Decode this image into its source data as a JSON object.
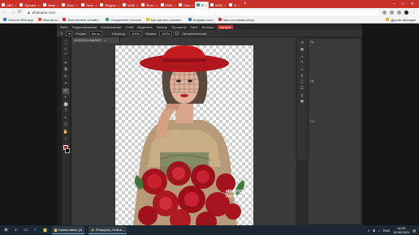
{
  "browser": {
    "tabs": [
      {
        "label": "НКП"
      },
      {
        "label": "Прочее"
      },
      {
        "label": "Ивар"
      },
      {
        "label": "Пинт"
      },
      {
        "label": "Окно"
      },
      {
        "label": "Яндекс"
      },
      {
        "label": "ИНВ"
      },
      {
        "label": "Фото"
      },
      {
        "label": "ИНВ"
      },
      {
        "label": "Пин"
      },
      {
        "label": "Ф"
      },
      {
        "label": "ИНВ"
      },
      {
        "label": "Ф"
      }
    ],
    "url": "photopea.com",
    "bookmarks": [
      {
        "label": "Outlook Web App",
        "color": "#2b7bd6"
      },
      {
        "label": "Мои фото",
        "color": "#e5572b"
      },
      {
        "label": "Бесплатные онлайн...",
        "color": "#c33"
      },
      {
        "label": "Сохранение текстов",
        "color": "#38a04a"
      },
      {
        "label": "Как сделать ссылки...",
        "color": "#e7b21a"
      },
      {
        "label": "Алфавит кого",
        "color": "#2b7bd6"
      },
      {
        "label": "Как состоянию книгу",
        "color": "#c33"
      },
      {
        "label": "Другие закладки",
        "color": "#e7b21a"
      }
    ]
  },
  "photopea": {
    "menu": [
      "Файл",
      "Редактирование",
      "Изображение",
      "Слой",
      "Выделить",
      "Фильтр",
      "Просмотр",
      "Окно",
      "Больше",
      "Аккаунт"
    ],
    "options": {
      "mode_label": "Режим",
      "mode_value": "Кисть",
      "opacity_label": "Непрозр.",
      "opacity_value": "100%",
      "flow_label": "Нажим",
      "flow_value": "100%",
      "auto_label": "Автоматический"
    },
    "doc_tab": "20210914-WA0007",
    "tools": [
      "⬚",
      "⊹",
      "⌒",
      "✦",
      "⧉",
      "✎",
      "⌖",
      "✐",
      "◐",
      "⬤",
      "T",
      "↖",
      "⬡",
      "✋",
      "⌕"
    ],
    "right_panel": {
      "labels": [
        "Пр.",
        "Цв.",
        "Сл."
      ]
    },
    "watermark_title": "#PHOTOLAB",
    "watermark_sub": "photolab.me"
  },
  "taskbar": {
    "apps": [
      {
        "label": "Новая папка (2)"
      },
      {
        "label": "Photopea | Online..."
      }
    ],
    "lang": "RUS",
    "time": "14:23",
    "date": "14.09.2021"
  }
}
